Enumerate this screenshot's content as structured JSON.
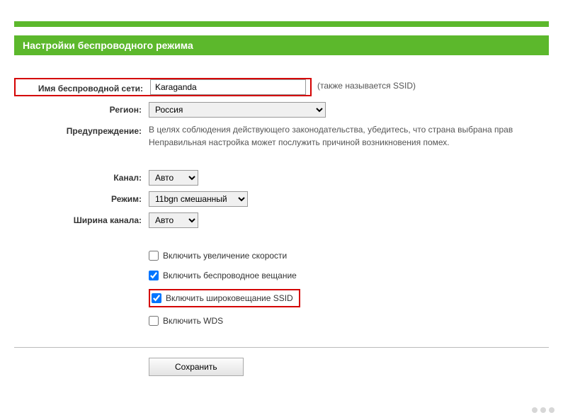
{
  "header": {
    "title": "Настройки беспроводного режима"
  },
  "labels": {
    "ssid": "Имя беспроводной сети:",
    "region": "Регион:",
    "warning": "Предупреждение:",
    "channel": "Канал:",
    "mode": "Режим:",
    "channel_width": "Ширина канала:"
  },
  "values": {
    "ssid": "Karaganda",
    "region": "Россия",
    "channel": "Авто",
    "mode": "11bgn смешанный",
    "channel_width": "Авто"
  },
  "hints": {
    "ssid_aka": "(также называется SSID)",
    "warning_line1": "В целях соблюдения действующего законодательства, убедитесь, что страна выбрана прав",
    "warning_line2": "Неправильная настройка может послужить причиной возникновения помех."
  },
  "checkboxes": {
    "speed_boost": {
      "label": "Включить увеличение скорости",
      "checked": false
    },
    "enable_wireless": {
      "label": "Включить беспроводное вещание",
      "checked": true
    },
    "enable_ssid_broadcast": {
      "label": "Включить широковещание SSID",
      "checked": true
    },
    "enable_wds": {
      "label": "Включить WDS",
      "checked": false
    }
  },
  "buttons": {
    "save": "Сохранить"
  }
}
